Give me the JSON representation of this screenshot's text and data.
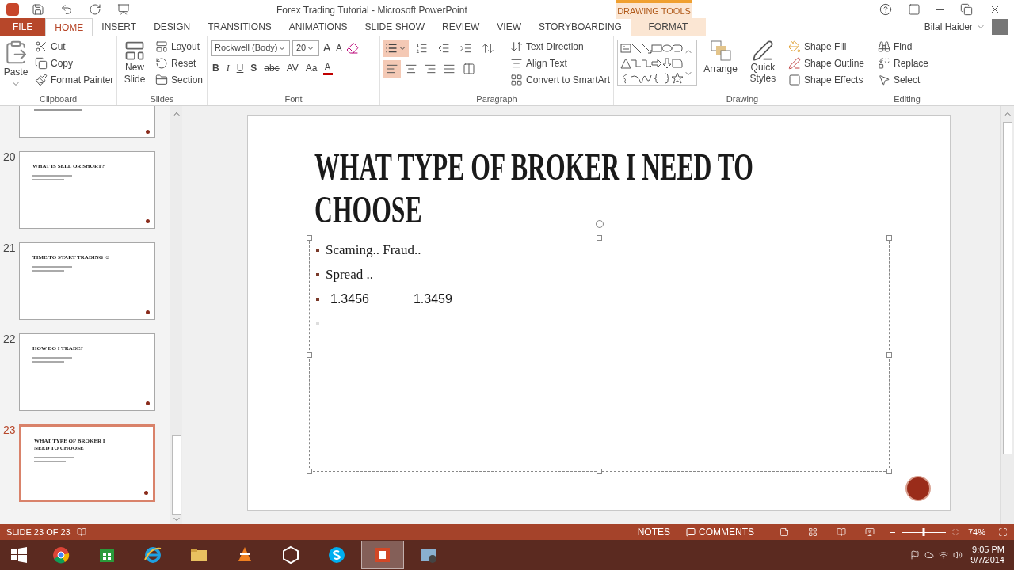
{
  "window": {
    "title": "Forex Trading Tutorial - Microsoft PowerPoint",
    "contextual_header": "DRAWING TOOLS",
    "user": "Bilal Haider"
  },
  "tabs": [
    {
      "label": "FILE",
      "kind": "file",
      "selected": false
    },
    {
      "label": "HOME",
      "kind": "normal",
      "selected": true
    },
    {
      "label": "INSERT",
      "kind": "normal",
      "selected": false
    },
    {
      "label": "DESIGN",
      "kind": "normal",
      "selected": false
    },
    {
      "label": "TRANSITIONS",
      "kind": "normal",
      "selected": false
    },
    {
      "label": "ANIMATIONS",
      "kind": "normal",
      "selected": false
    },
    {
      "label": "SLIDE SHOW",
      "kind": "normal",
      "selected": false
    },
    {
      "label": "REVIEW",
      "kind": "normal",
      "selected": false
    },
    {
      "label": "VIEW",
      "kind": "normal",
      "selected": false
    },
    {
      "label": "STORYBOARDING",
      "kind": "normal",
      "selected": false
    },
    {
      "label": "FORMAT",
      "kind": "contextual",
      "selected": false
    }
  ],
  "clipboard": {
    "title": "Clipboard",
    "paste": "Paste",
    "cut": "Cut",
    "copy": "Copy",
    "format_painter": "Format Painter"
  },
  "slides_group": {
    "title": "Slides",
    "new_slide": "New Slide",
    "layout": "Layout",
    "reset": "Reset",
    "section": "Section"
  },
  "font": {
    "title": "Font",
    "font_name": "Rockwell (Body)",
    "font_size": "20",
    "grow": "A",
    "shrink": "A",
    "format_buttons": [
      "B",
      "I",
      "U",
      "S",
      "abc",
      "AV",
      "Aa"
    ],
    "color_button": "A"
  },
  "paragraph": {
    "title": "Paragraph",
    "bullets_selected": true,
    "alignments": [
      {
        "kind": "left",
        "selected": true
      },
      {
        "kind": "center",
        "selected": false
      },
      {
        "kind": "right",
        "selected": false
      },
      {
        "kind": "justify",
        "selected": false
      }
    ],
    "text_direction": "Text Direction",
    "align_text": "Align Text",
    "convert": "Convert to SmartArt"
  },
  "drawing": {
    "title": "Drawing",
    "arrange": "Arrange",
    "quick_styles": "Quick Styles",
    "shape_fill": "Shape Fill",
    "shape_outline": "Shape Outline",
    "shape_effects": "Shape Effects"
  },
  "editing": {
    "title": "Editing",
    "find": "Find",
    "replace": "Replace",
    "select": "Select"
  },
  "thumbnails": [
    {
      "kind": "partial",
      "selected": false
    },
    {
      "kind": "slide",
      "number": "20",
      "title": "WHAT IS SELL OR SHORT?",
      "selected": false
    },
    {
      "kind": "slide",
      "number": "21",
      "title": "TIME TO START TRADING ☺",
      "selected": false
    },
    {
      "kind": "slide",
      "number": "22",
      "title": "HOW DO I TRADE?",
      "selected": false
    },
    {
      "kind": "slide",
      "number": "23",
      "title": "WHAT TYPE OF BROKER I NEED TO CHOOSE",
      "selected": true
    }
  ],
  "slide": {
    "title": "WHAT TYPE OF BROKER I NEED TO CHOOSE",
    "bullets": [
      {
        "kind": "text",
        "text": "Scaming.. Fraud.."
      },
      {
        "kind": "text",
        "text": "Spread .."
      },
      {
        "kind": "columns",
        "columns": [
          "1.3456",
          "1.3459"
        ]
      },
      {
        "kind": "empty"
      }
    ]
  },
  "status_bar": {
    "slide_info": "SLIDE 23 OF 23",
    "notes": "NOTES",
    "comments": "COMMENTS",
    "zoom": {
      "level": 0.5,
      "reading": "74%"
    }
  },
  "taskbar": {
    "apps": [
      {
        "kind": "chrome",
        "selected": false
      },
      {
        "kind": "store",
        "selected": false
      },
      {
        "kind": "ie",
        "selected": false
      },
      {
        "kind": "explorer",
        "selected": false
      },
      {
        "kind": "vlc",
        "selected": false
      },
      {
        "kind": "unity",
        "selected": false
      },
      {
        "kind": "skype",
        "selected": false
      },
      {
        "kind": "powerpoint",
        "selected": true
      },
      {
        "kind": "video",
        "selected": false
      }
    ],
    "time": "9:05 PM",
    "date": "9/7/2014"
  }
}
